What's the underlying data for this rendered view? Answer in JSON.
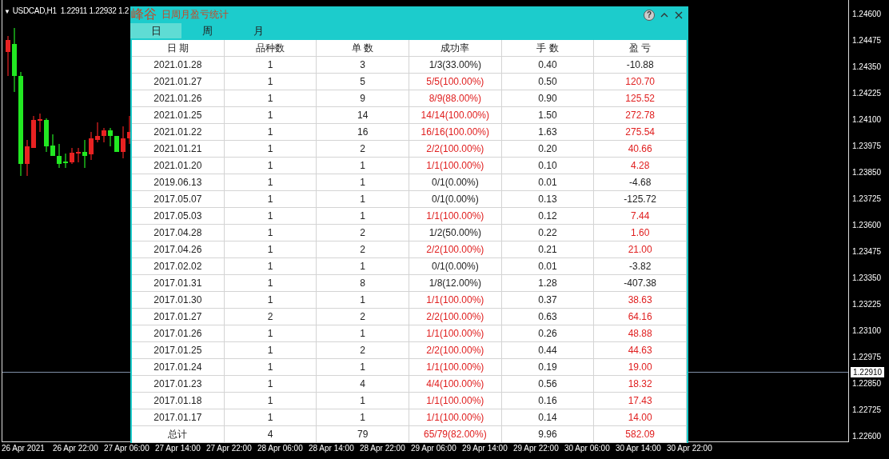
{
  "chart": {
    "marker": "▼",
    "symbol": "USDCAD,H1",
    "quotes": "1.22911 1.22932 1.2",
    "price_axis": [
      "1.24600",
      "1.24475",
      "1.24350",
      "1.24225",
      "1.24100",
      "1.23975",
      "1.23850",
      "1.23725",
      "1.23600",
      "1.23475",
      "1.23350",
      "1.23225",
      "1.23100",
      "1.22975",
      "1.22850",
      "1.22725",
      "1.22600"
    ],
    "current_price": "1.22910",
    "time_axis": [
      "26 Apr 2021",
      "26 Apr 22:00",
      "27 Apr 06:00",
      "27 Apr 14:00",
      "27 Apr 22:00",
      "28 Apr 06:00",
      "28 Apr 14:00",
      "28 Apr 22:00",
      "29 Apr 06:00",
      "29 Apr 14:00",
      "29 Apr 22:00",
      "30 Apr 06:00",
      "30 Apr 14:00",
      "30 Apr 22:00"
    ]
  },
  "panel": {
    "logo": "峰谷",
    "title": "日周月盈亏统计",
    "help": "?",
    "tabs": [
      {
        "label": "日",
        "selected": true
      },
      {
        "label": "周",
        "selected": false
      },
      {
        "label": "月",
        "selected": false
      }
    ],
    "columns": [
      "日 期",
      "品种数",
      "单 数",
      "成功率",
      "手 数",
      "盈 亏"
    ],
    "rows": [
      {
        "date": "2021.01.28",
        "symbols": "1",
        "orders": "3",
        "rate": "1/3(33.00%)",
        "lots": "0.40",
        "profit": "-10.88",
        "rate_highlight": false,
        "profit_highlight": false
      },
      {
        "date": "2021.01.27",
        "symbols": "1",
        "orders": "5",
        "rate": "5/5(100.00%)",
        "lots": "0.50",
        "profit": "120.70",
        "rate_highlight": true,
        "profit_highlight": true
      },
      {
        "date": "2021.01.26",
        "symbols": "1",
        "orders": "9",
        "rate": "8/9(88.00%)",
        "lots": "0.90",
        "profit": "125.52",
        "rate_highlight": true,
        "profit_highlight": true
      },
      {
        "date": "2021.01.25",
        "symbols": "1",
        "orders": "14",
        "rate": "14/14(100.00%)",
        "lots": "1.50",
        "profit": "272.78",
        "rate_highlight": true,
        "profit_highlight": true
      },
      {
        "date": "2021.01.22",
        "symbols": "1",
        "orders": "16",
        "rate": "16/16(100.00%)",
        "lots": "1.63",
        "profit": "275.54",
        "rate_highlight": true,
        "profit_highlight": true
      },
      {
        "date": "2021.01.21",
        "symbols": "1",
        "orders": "2",
        "rate": "2/2(100.00%)",
        "lots": "0.20",
        "profit": "40.66",
        "rate_highlight": true,
        "profit_highlight": true
      },
      {
        "date": "2021.01.20",
        "symbols": "1",
        "orders": "1",
        "rate": "1/1(100.00%)",
        "lots": "0.10",
        "profit": "4.28",
        "rate_highlight": true,
        "profit_highlight": true
      },
      {
        "date": "2019.06.13",
        "symbols": "1",
        "orders": "1",
        "rate": "0/1(0.00%)",
        "lots": "0.01",
        "profit": "-4.68",
        "rate_highlight": false,
        "profit_highlight": false
      },
      {
        "date": "2017.05.07",
        "symbols": "1",
        "orders": "1",
        "rate": "0/1(0.00%)",
        "lots": "0.13",
        "profit": "-125.72",
        "rate_highlight": false,
        "profit_highlight": false
      },
      {
        "date": "2017.05.03",
        "symbols": "1",
        "orders": "1",
        "rate": "1/1(100.00%)",
        "lots": "0.12",
        "profit": "7.44",
        "rate_highlight": true,
        "profit_highlight": true
      },
      {
        "date": "2017.04.28",
        "symbols": "1",
        "orders": "2",
        "rate": "1/2(50.00%)",
        "lots": "0.22",
        "profit": "1.60",
        "rate_highlight": false,
        "profit_highlight": true
      },
      {
        "date": "2017.04.26",
        "symbols": "1",
        "orders": "2",
        "rate": "2/2(100.00%)",
        "lots": "0.21",
        "profit": "21.00",
        "rate_highlight": true,
        "profit_highlight": true
      },
      {
        "date": "2017.02.02",
        "symbols": "1",
        "orders": "1",
        "rate": "0/1(0.00%)",
        "lots": "0.01",
        "profit": "-3.82",
        "rate_highlight": false,
        "profit_highlight": false
      },
      {
        "date": "2017.01.31",
        "symbols": "1",
        "orders": "8",
        "rate": "1/8(12.00%)",
        "lots": "1.28",
        "profit": "-407.38",
        "rate_highlight": false,
        "profit_highlight": false
      },
      {
        "date": "2017.01.30",
        "symbols": "1",
        "orders": "1",
        "rate": "1/1(100.00%)",
        "lots": "0.37",
        "profit": "38.63",
        "rate_highlight": true,
        "profit_highlight": true
      },
      {
        "date": "2017.01.27",
        "symbols": "2",
        "orders": "2",
        "rate": "2/2(100.00%)",
        "lots": "0.63",
        "profit": "64.16",
        "rate_highlight": true,
        "profit_highlight": true
      },
      {
        "date": "2017.01.26",
        "symbols": "1",
        "orders": "1",
        "rate": "1/1(100.00%)",
        "lots": "0.26",
        "profit": "48.88",
        "rate_highlight": true,
        "profit_highlight": true
      },
      {
        "date": "2017.01.25",
        "symbols": "1",
        "orders": "2",
        "rate": "2/2(100.00%)",
        "lots": "0.44",
        "profit": "44.63",
        "rate_highlight": true,
        "profit_highlight": true
      },
      {
        "date": "2017.01.24",
        "symbols": "1",
        "orders": "1",
        "rate": "1/1(100.00%)",
        "lots": "0.19",
        "profit": "19.00",
        "rate_highlight": true,
        "profit_highlight": true
      },
      {
        "date": "2017.01.23",
        "symbols": "1",
        "orders": "4",
        "rate": "4/4(100.00%)",
        "lots": "0.56",
        "profit": "18.32",
        "rate_highlight": true,
        "profit_highlight": true
      },
      {
        "date": "2017.01.18",
        "symbols": "1",
        "orders": "1",
        "rate": "1/1(100.00%)",
        "lots": "0.16",
        "profit": "17.43",
        "rate_highlight": true,
        "profit_highlight": true
      },
      {
        "date": "2017.01.17",
        "symbols": "1",
        "orders": "1",
        "rate": "1/1(100.00%)",
        "lots": "0.14",
        "profit": "14.00",
        "rate_highlight": true,
        "profit_highlight": true
      }
    ],
    "total": {
      "date": "总计",
      "symbols": "4",
      "orders": "79",
      "rate": "65/79(82.00%)",
      "lots": "9.96",
      "profit": "582.09",
      "rate_highlight": true,
      "profit_highlight": true
    }
  }
}
